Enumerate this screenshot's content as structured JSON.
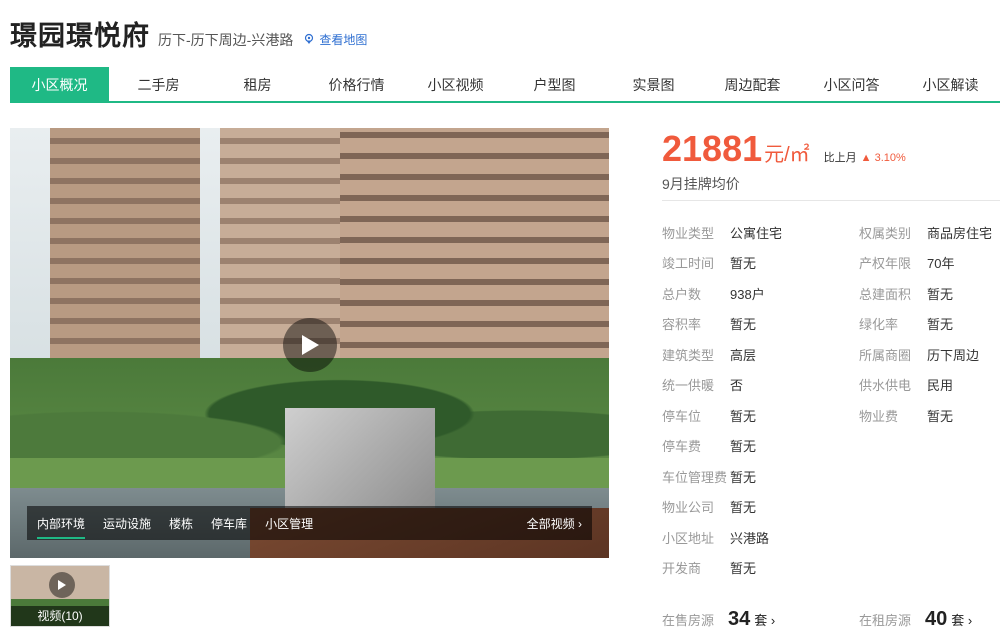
{
  "header": {
    "title": "璟园璟悦府",
    "location": "历下-历下周边-兴港路",
    "map_link": "查看地图"
  },
  "tabs": [
    {
      "label": "小区概况",
      "active": true
    },
    {
      "label": "二手房"
    },
    {
      "label": "租房"
    },
    {
      "label": "价格行情"
    },
    {
      "label": "小区视频"
    },
    {
      "label": "户型图"
    },
    {
      "label": "实景图"
    },
    {
      "label": "周边配套"
    },
    {
      "label": "小区问答"
    },
    {
      "label": "小区解读"
    }
  ],
  "media": {
    "tabs": [
      "内部环境",
      "运动设施",
      "楼栋",
      "停车库",
      "小区管理"
    ],
    "active_tab": "内部环境",
    "all_videos": "全部视频 ›",
    "thumb_label": "视频(10)"
  },
  "price": {
    "value": "21881",
    "unit": "元/㎡",
    "mom_label": "比上月",
    "mom_change": "▲ 3.10%",
    "desc": "9月挂牌均价"
  },
  "info": {
    "left": [
      {
        "label": "物业类型",
        "value": "公寓住宅"
      },
      {
        "label": "竣工时间",
        "value": "暂无"
      },
      {
        "label": "总户数",
        "value": "938户"
      },
      {
        "label": "容积率",
        "value": "暂无"
      },
      {
        "label": "建筑类型",
        "value": "高层"
      },
      {
        "label": "统一供暖",
        "value": "否"
      },
      {
        "label": "停车位",
        "value": "暂无"
      },
      {
        "label": "停车费",
        "value": "暂无"
      },
      {
        "label": "车位管理费",
        "value": "暂无"
      },
      {
        "label": "物业公司",
        "value": "暂无"
      },
      {
        "label": "小区地址",
        "value": "兴港路"
      },
      {
        "label": "开发商",
        "value": "暂无"
      }
    ],
    "right": [
      {
        "label": "权属类别",
        "value": "商品房住宅"
      },
      {
        "label": "产权年限",
        "value": "70年"
      },
      {
        "label": "总建面积",
        "value": "暂无"
      },
      {
        "label": "绿化率",
        "value": "暂无"
      },
      {
        "label": "所属商圈",
        "value": "历下周边"
      },
      {
        "label": "供水供电",
        "value": "民用"
      },
      {
        "label": "物业费",
        "value": "暂无"
      }
    ]
  },
  "counts": {
    "sale_label": "在售房源",
    "sale_num": "34",
    "sale_unit": "套 ›",
    "rent_label": "在租房源",
    "rent_num": "40",
    "rent_unit": "套 ›"
  }
}
